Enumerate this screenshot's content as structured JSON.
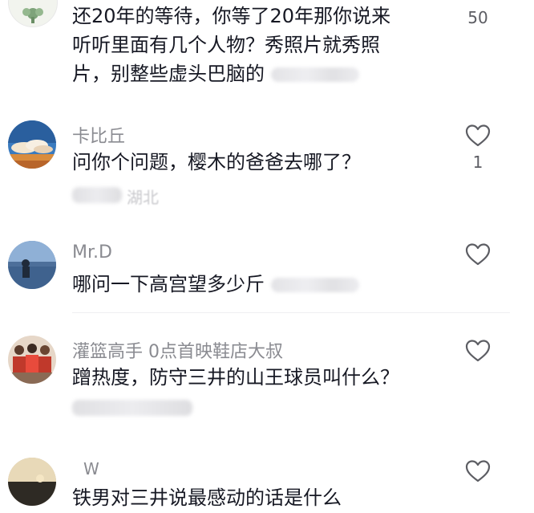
{
  "comments": [
    {
      "id": "c0",
      "username": "",
      "lines": [
        "还20年的等待，你等了20年那你说来",
        "听听里面有几个人物？秀照片就秀照",
        "片，别整些虚头巴脑的"
      ],
      "like_count": "50"
    },
    {
      "id": "c1",
      "username": "卡比丘",
      "lines": [
        "问你个问题，樱木的爸爸去哪了？"
      ],
      "meta_text": "湖北",
      "like_count": "1"
    },
    {
      "id": "c2",
      "username": "Mr.D",
      "lines": [
        "哪问一下高宫望多少斤"
      ],
      "like_count": ""
    },
    {
      "id": "c3",
      "username": "灌篮高手 0点首映鞋店大叔",
      "lines": [
        "蹭热度，防守三井的山王球员叫什么？"
      ],
      "like_count": ""
    },
    {
      "id": "c4",
      "username": "W",
      "lines": [
        "铁男对三井说最感动的话是什么"
      ],
      "like_count": ""
    }
  ],
  "icons": {
    "like": "heart-outline-icon"
  },
  "colors": {
    "username": "#8a8b91",
    "text": "#161823",
    "icon": "#5c5d63"
  }
}
